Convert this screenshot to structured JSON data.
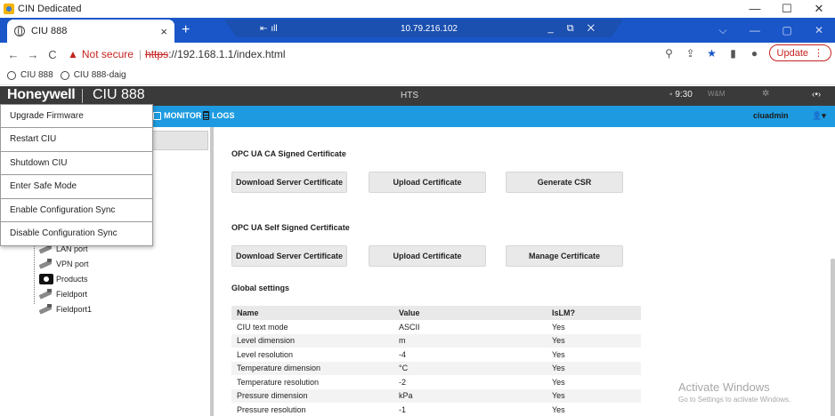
{
  "window": {
    "title": "CIN Dedicated",
    "controls": [
      "—",
      "☐",
      "✕"
    ]
  },
  "browser": {
    "tab_title": "CIU 888",
    "tab_close": "×",
    "new_tab": "+",
    "remote": {
      "ip": "10.79.216.102",
      "signal": "ıll",
      "pin": "⇤",
      "controls": "_ ⧉ ✕"
    },
    "tabbar_controls": [
      "⌵",
      "—",
      "▢",
      "✕"
    ],
    "nav": {
      "back": "←",
      "forward": "→",
      "reload": "C"
    },
    "not_secure": "Not secure",
    "url_scheme": "https",
    "url_rest": "://192.168.1.1/index.html",
    "update_label": "Update",
    "bookmarks": [
      "CIU 888",
      "CIU 888-daig"
    ]
  },
  "app": {
    "brand": "Honeywell",
    "product": "CIU 888",
    "center_label": "HTS",
    "time": "9:30",
    "wm_label": "W&M",
    "nav": {
      "monitor": "MONITOR",
      "logs": "LOGS",
      "user": "ciuadmin"
    }
  },
  "dropdown": {
    "items": [
      "Upgrade Firmware",
      "Restart CIU",
      "Shutdown CIU",
      "Enter Safe Mode",
      "Enable Configuration Sync",
      "Disable Configuration Sync"
    ]
  },
  "tree": {
    "items": [
      "LAN port",
      "VPN port",
      "Products",
      "Fieldport",
      "Fieldport1"
    ]
  },
  "main": {
    "ca_title": "OPC UA CA Signed Certificate",
    "ca_buttons": [
      "Download Server Certificate",
      "Upload Certificate",
      "Generate CSR"
    ],
    "self_title": "OPC UA Self Signed Certificate",
    "self_buttons": [
      "Download Server Certificate",
      "Upload Certificate",
      "Manage Certificate"
    ],
    "global_title": "Global settings",
    "table": {
      "headers": [
        "Name",
        "Value",
        "IsLM?"
      ],
      "rows": [
        [
          "CIU text mode",
          "ASCII",
          "Yes"
        ],
        [
          "Level dimension",
          "m",
          "Yes"
        ],
        [
          "Level resolution",
          "-4",
          "Yes"
        ],
        [
          "Temperature dimension",
          "°C",
          "Yes"
        ],
        [
          "Temperature resolution",
          "-2",
          "Yes"
        ],
        [
          "Pressure dimension",
          "kPa",
          "Yes"
        ],
        [
          "Pressure resolution",
          "-1",
          "Yes"
        ]
      ]
    }
  },
  "watermark": {
    "line1": "Activate Windows",
    "line2": "Go to Settings to activate Windows."
  }
}
